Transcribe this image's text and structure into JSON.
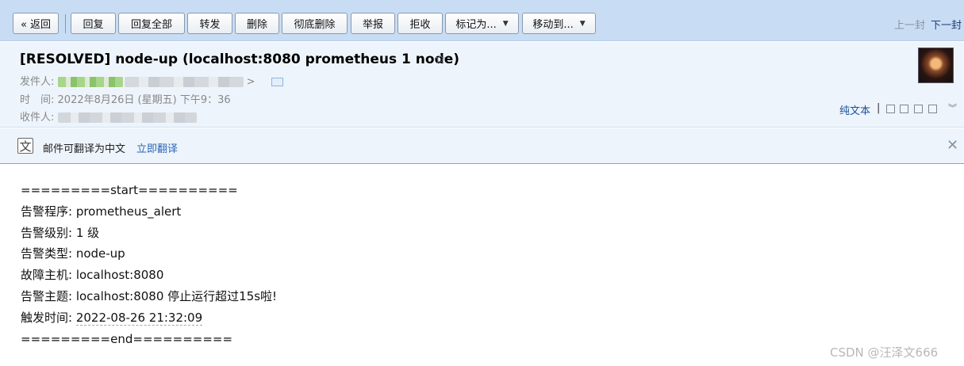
{
  "toolbar": {
    "back": "« 返回",
    "reply": "回复",
    "reply_all": "回复全部",
    "forward": "转发",
    "delete": "删除",
    "delete_forever": "彻底删除",
    "report": "举报",
    "reject": "拒收",
    "mark_as": "标记为...",
    "move_to": "移动到...",
    "prev": "上一封",
    "next": "下一封"
  },
  "header": {
    "subject": "[RESOLVED] node-up (localhost:8080 prometheus 1 node)",
    "from_label": "发件人:",
    "from_suffix": ">",
    "time_label": "时　间:",
    "time_value": "2022年8月26日 (星期五) 下午9：36",
    "to_label": "收件人:",
    "plain_text": "纯文本",
    "divider": "|"
  },
  "translate": {
    "message": "邮件可翻译为中文",
    "action": "立即翻译"
  },
  "body": {
    "lines": [
      "=========start==========",
      "告警程序: prometheus_alert",
      "告警级别: 1 级",
      "告警类型: node-up",
      "故障主机: localhost:8080",
      "告警主题: localhost:8080 停止运行超过15s啦!"
    ],
    "time_prefix": "触发时间: ",
    "time_value": "2022-08-26 21:32:09",
    "end_line": "=========end=========="
  },
  "watermark": "CSDN @汪泽文666",
  "icons": {
    "star": "star-icon",
    "contact_card": "contact-card-icon",
    "translate": "translate-icon",
    "close": "close-icon"
  }
}
